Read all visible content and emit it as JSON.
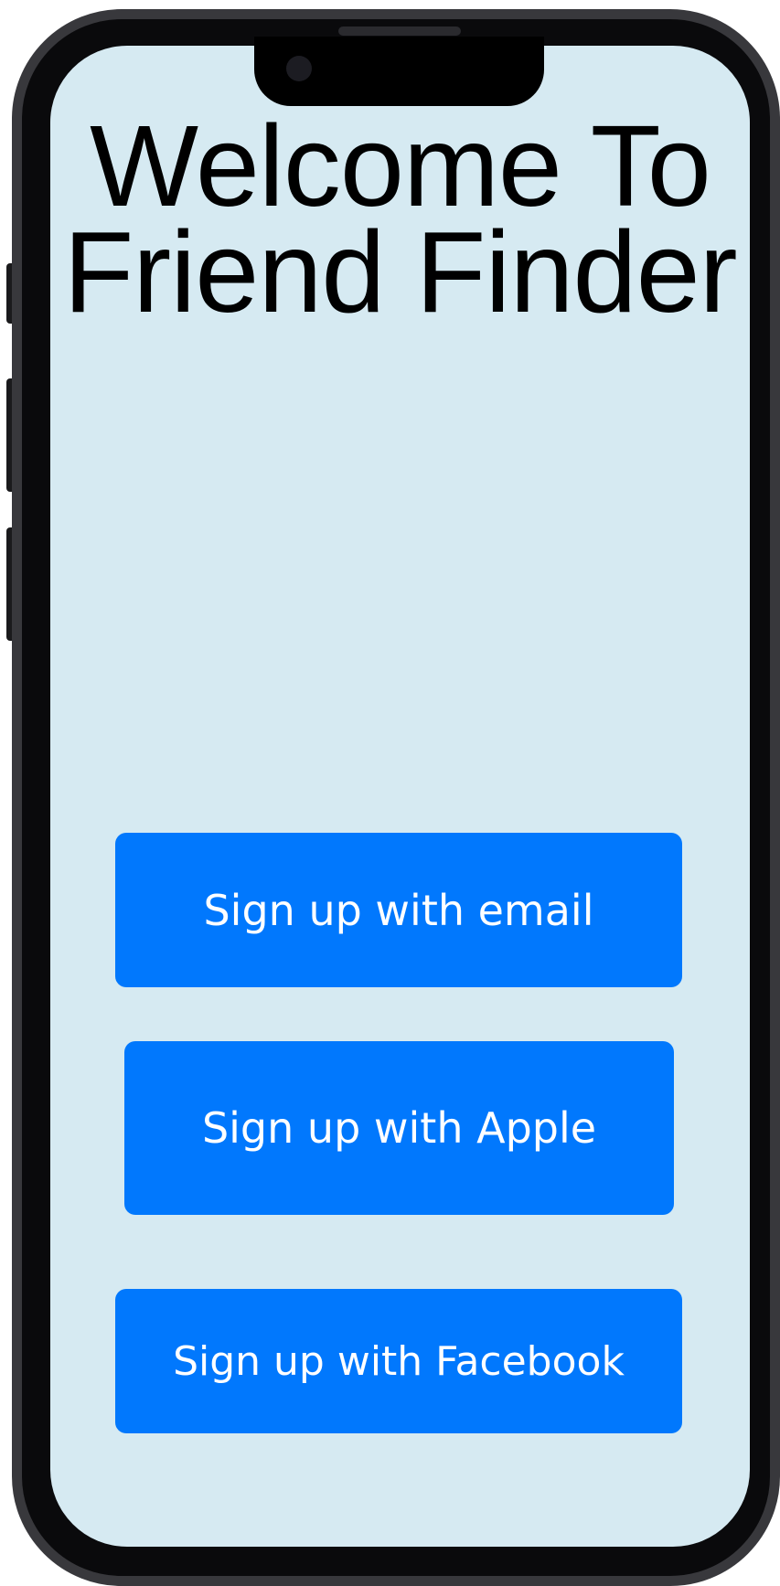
{
  "screen": {
    "title": "Welcome To Friend Finder",
    "background_color": "#d6eaf2"
  },
  "buttons": {
    "email_label": "Sign up with email",
    "apple_label": "Sign up with Apple",
    "facebook_label": "Sign up with Facebook",
    "color": "#0178fd",
    "text_color": "#ffffff"
  }
}
